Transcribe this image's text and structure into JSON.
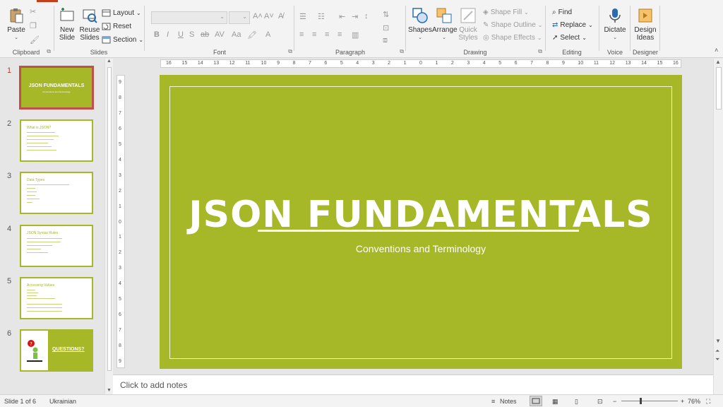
{
  "ribbon": {
    "clipboard": {
      "label": "Clipboard",
      "paste": "Paste"
    },
    "slides": {
      "label": "Slides",
      "new_slide": "New Slide",
      "reuse_slides": "Reuse Slides",
      "layout": "Layout",
      "reset": "Reset",
      "section": "Section"
    },
    "font": {
      "label": "Font"
    },
    "paragraph": {
      "label": "Paragraph"
    },
    "drawing": {
      "label": "Drawing",
      "shapes": "Shapes",
      "arrange": "Arrange",
      "quick_styles": "Quick Styles",
      "shape_fill": "Shape Fill",
      "shape_outline": "Shape Outline",
      "shape_effects": "Shape Effects"
    },
    "editing": {
      "label": "Editing",
      "find": "Find",
      "replace": "Replace",
      "select": "Select"
    },
    "voice": {
      "label": "Voice",
      "dictate": "Dictate"
    },
    "designer": {
      "label": "Designer",
      "design_ideas": "Design Ideas"
    }
  },
  "thumbnails": [
    {
      "num": "1",
      "title": "JSON FUNDAMENTALS",
      "subtitle": "Conventions and Terminology"
    },
    {
      "num": "2",
      "title": "What is JSON?"
    },
    {
      "num": "3",
      "title": "Data Types"
    },
    {
      "num": "4",
      "title": "JSON Syntax Rules"
    },
    {
      "num": "5",
      "title": "Accessing Values"
    },
    {
      "num": "6",
      "title": "QUESTIONS?"
    }
  ],
  "slide": {
    "title": "JSON FUNDAMENTALS",
    "subtitle": "Conventions and Terminology"
  },
  "notes": {
    "placeholder": "Click to add notes"
  },
  "status": {
    "slide_info": "Slide 1 of 6",
    "language": "Ukrainian",
    "notes_btn": "Notes",
    "zoom": "76%"
  },
  "rulers": {
    "horizontal": [
      "16",
      "15",
      "14",
      "13",
      "12",
      "11",
      "10",
      "9",
      "8",
      "7",
      "6",
      "5",
      "4",
      "3",
      "2",
      "1",
      "0",
      "1",
      "2",
      "3",
      "4",
      "5",
      "6",
      "7",
      "8",
      "9",
      "10",
      "11",
      "12",
      "13",
      "14",
      "15",
      "16"
    ],
    "vertical": [
      "9",
      "8",
      "7",
      "6",
      "5",
      "4",
      "3",
      "2",
      "1",
      "0",
      "1",
      "2",
      "3",
      "4",
      "5",
      "6",
      "7",
      "8",
      "9"
    ]
  },
  "colors": {
    "accent": "#a6b727",
    "office_red": "#c43e1c"
  }
}
